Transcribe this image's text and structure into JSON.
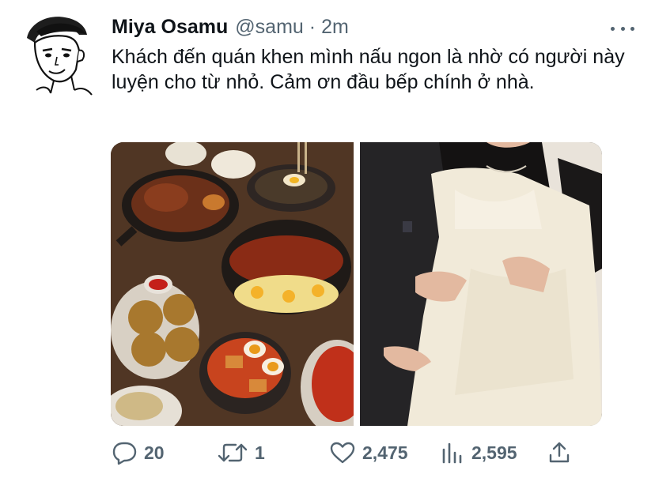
{
  "tweet": {
    "author_name": "Miya Osamu",
    "handle": "@samu",
    "separator": "·",
    "time": "2m",
    "text": "Khách đến quán khen mình nấu ngon là nhờ có người này luyện cho từ nhỏ. Cảm ơn đầu bếp chính ở nhà.",
    "avatar_icon": "anime-boy-avatar",
    "more_icon": "more-horizontal-icon"
  },
  "media": [
    {
      "subject": "food-spread-photo"
    },
    {
      "subject": "couple-photo"
    }
  ],
  "actions": {
    "replies": "20",
    "retweets": "1",
    "likes": "2,475",
    "views": "2,595"
  },
  "colors": {
    "text": "#0f1419",
    "muted": "#536471",
    "background": "#ffffff"
  }
}
